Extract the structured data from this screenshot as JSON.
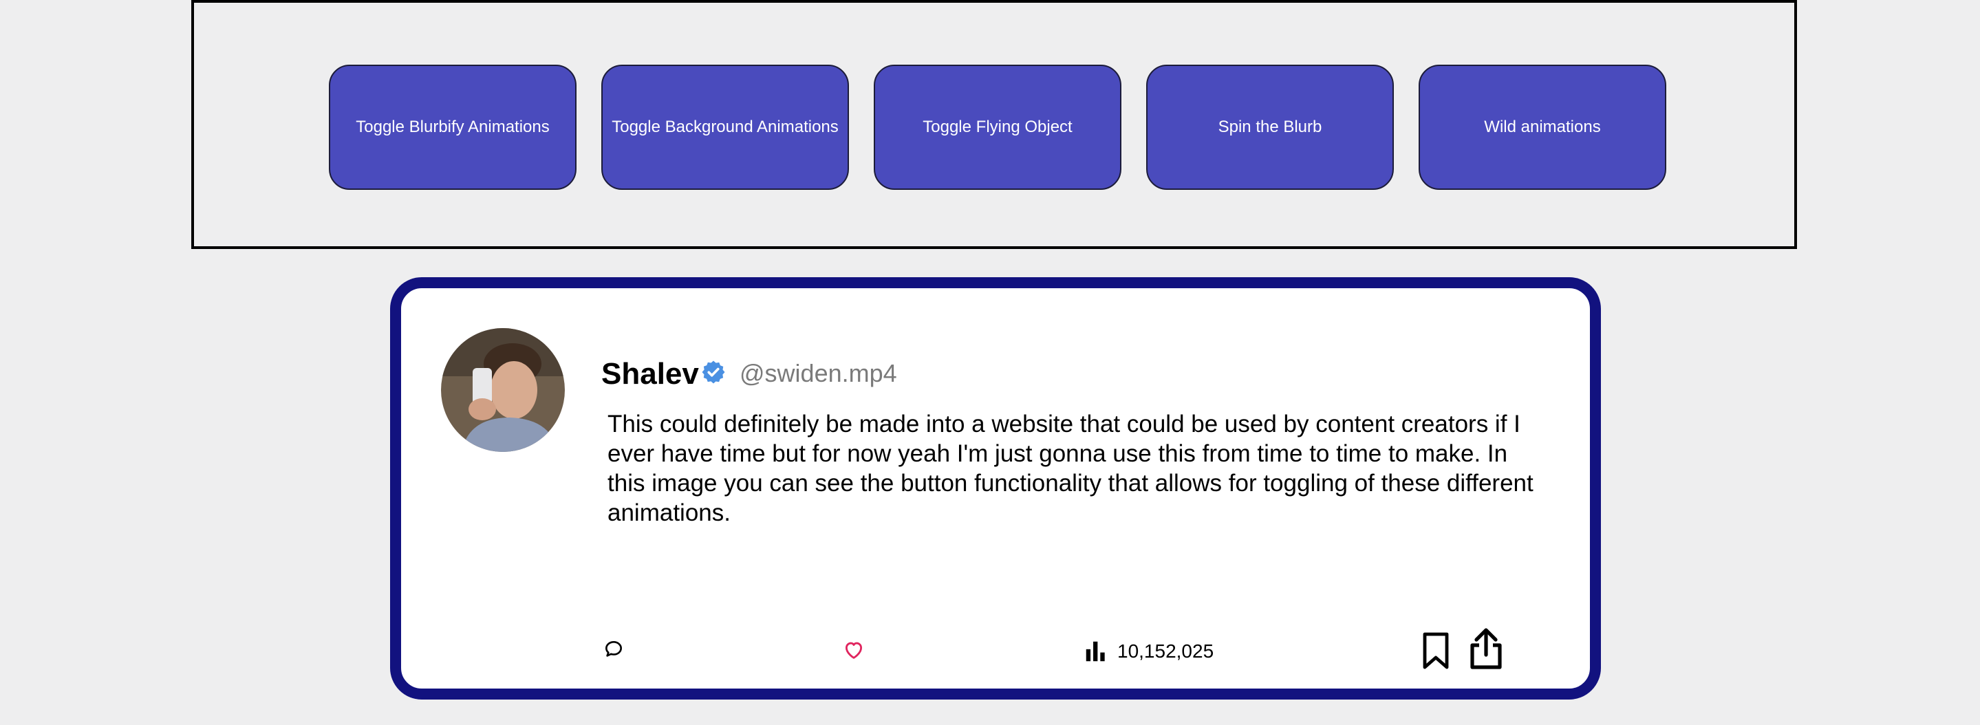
{
  "controls": {
    "buttons": [
      {
        "label": "Toggle Blurbify Animations"
      },
      {
        "label": "Toggle Background Animations"
      },
      {
        "label": "Toggle Flying Object"
      },
      {
        "label": "Spin the Blurb"
      },
      {
        "label": "Wild animations"
      }
    ]
  },
  "post": {
    "author_name": "Shalev",
    "handle": "@swiden.mp4",
    "text": "This could definitely be made into a website that could be used by content creators if I ever have time but for now yeah I'm just gonna use this from time to time to make. In this image you can see the button functionality that allows for toggling of these different animations.",
    "views": "10,152,025",
    "verified": true,
    "icons": {
      "reply": "comment-icon",
      "like": "heart-icon",
      "views": "bar-chart-icon",
      "bookmark": "bookmark-icon",
      "share": "share-icon",
      "verified": "verified-badge-icon"
    }
  },
  "colors": {
    "button_bg": "#4a4bbd",
    "card_border": "#12127f",
    "verified": "#4a90e2",
    "heart": "#e0245e",
    "handle": "#7a7a7a",
    "page_bg": "#eeeeef"
  }
}
